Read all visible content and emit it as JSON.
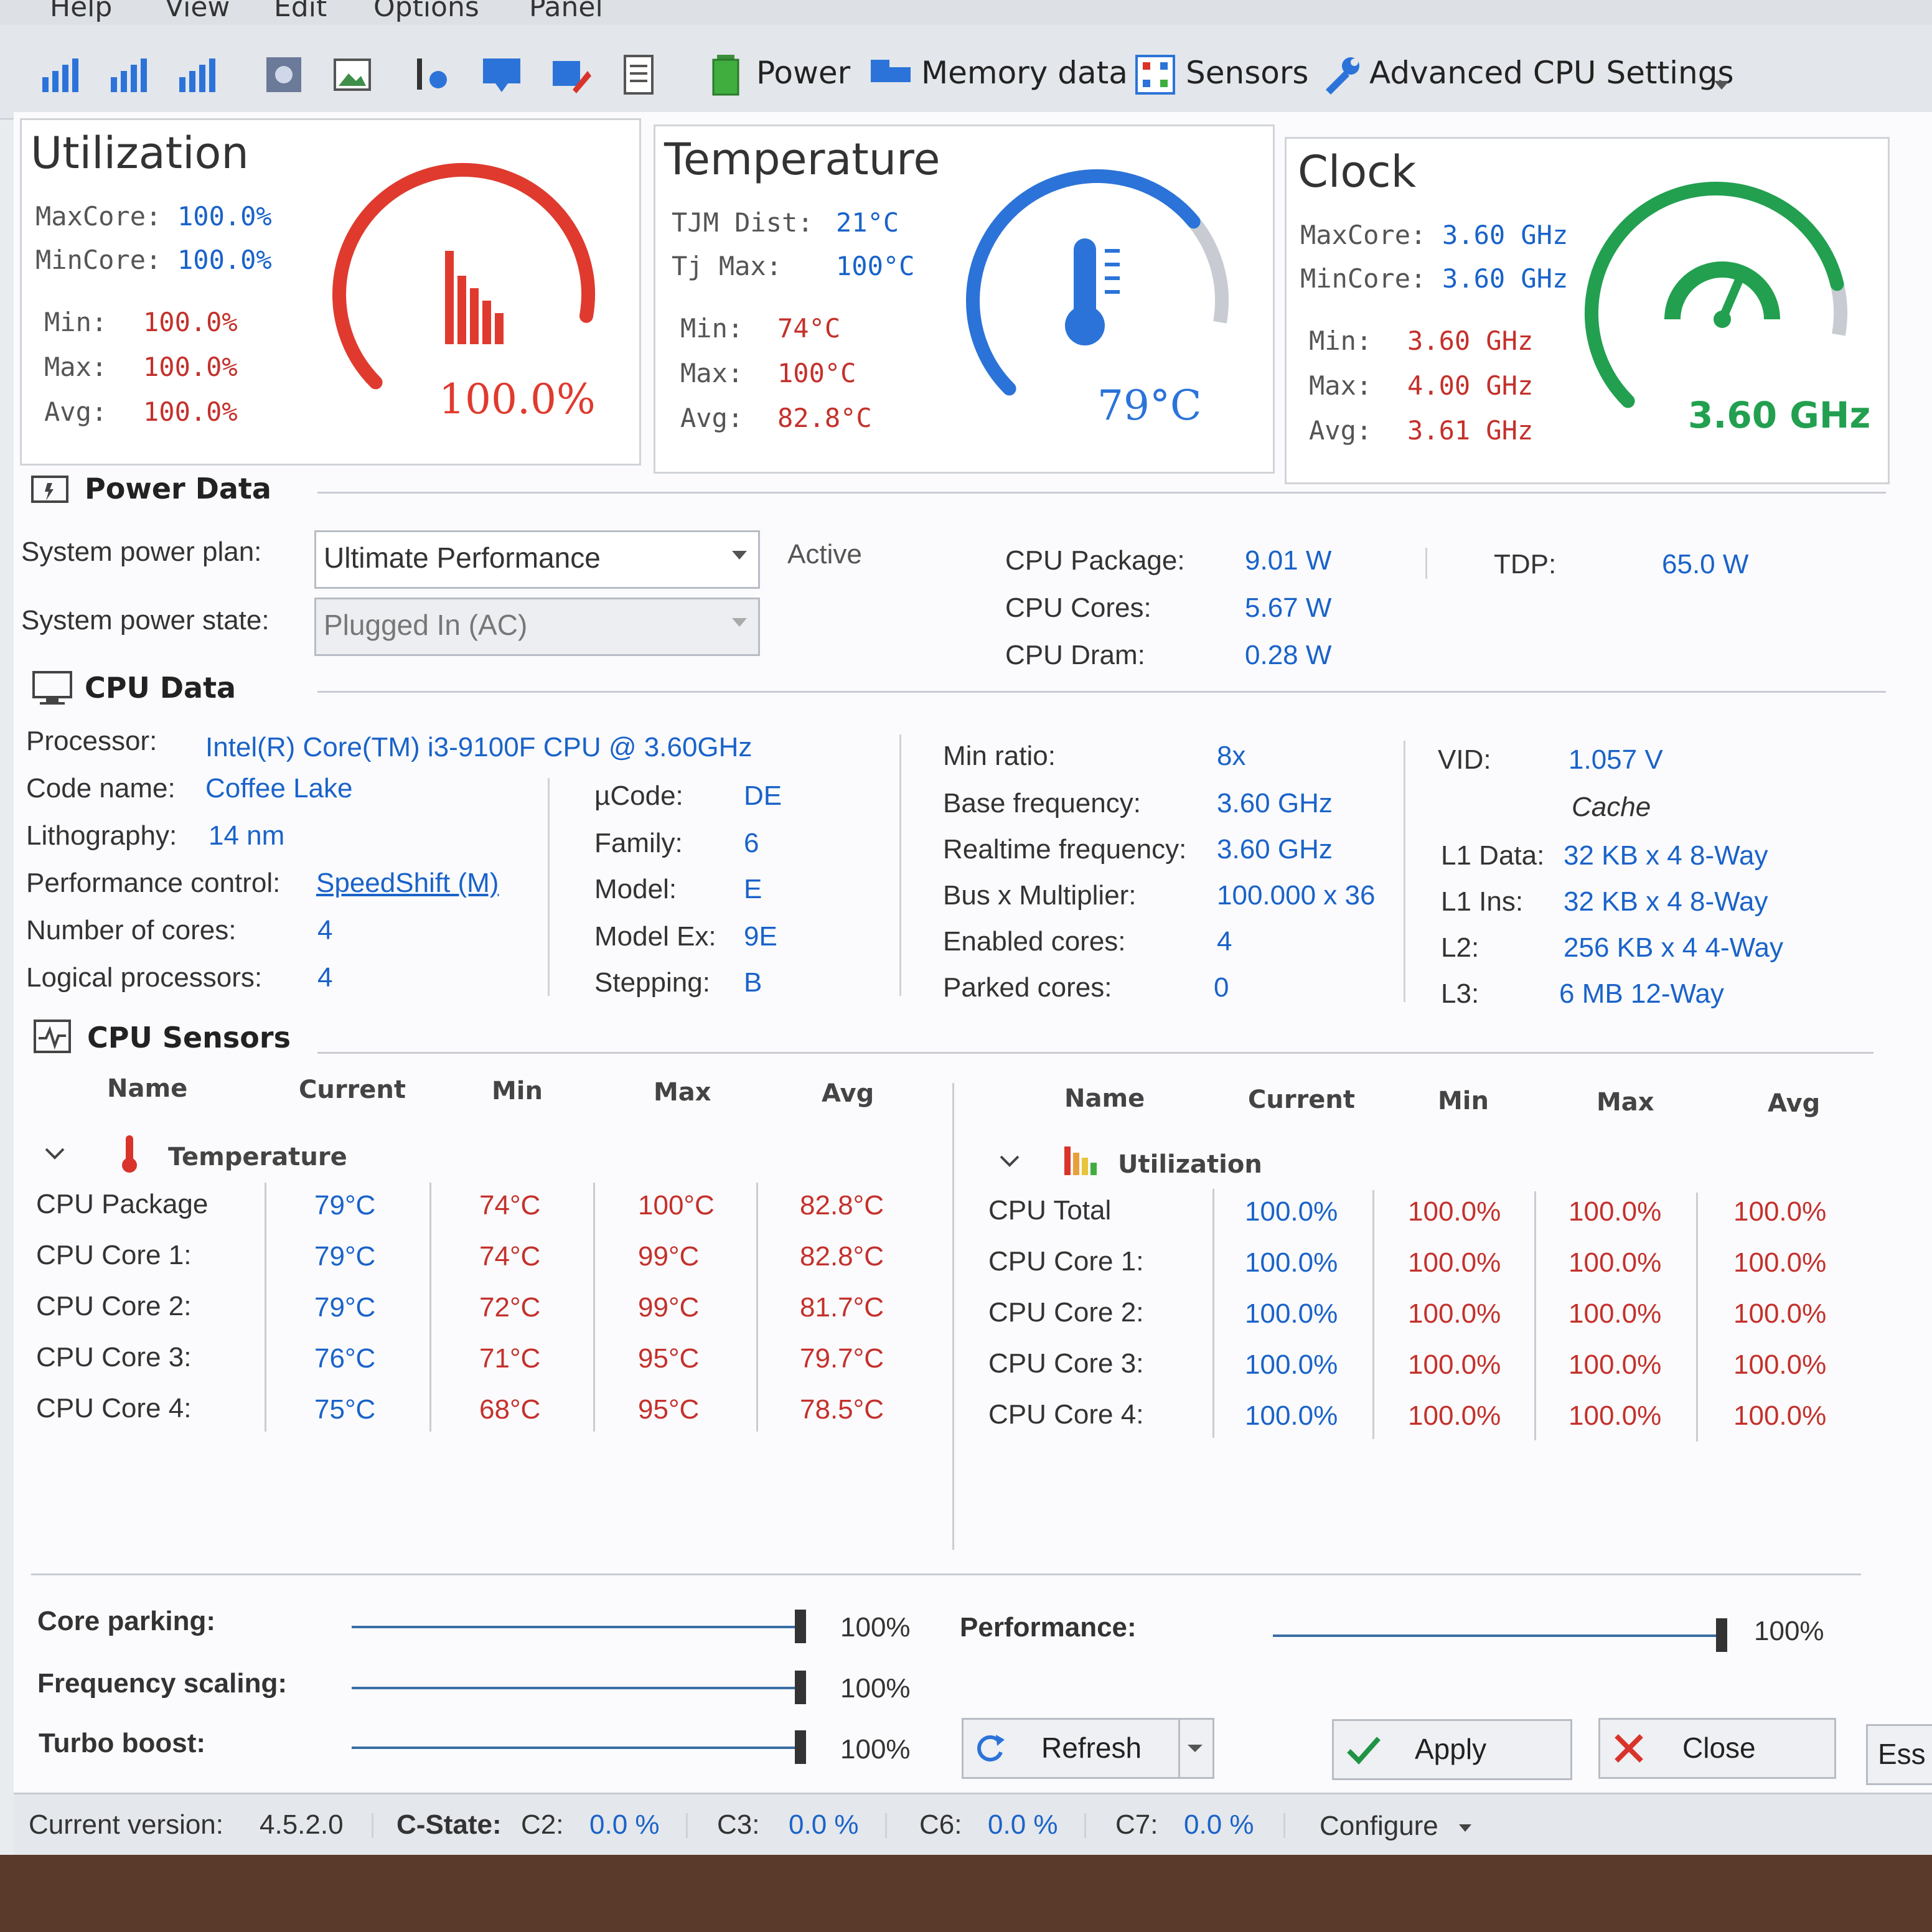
{
  "menu": [
    "Help",
    "View",
    "Edit",
    "Options",
    "Panel"
  ],
  "toolbar": {
    "power": "Power",
    "memory": "Memory data",
    "sensors": "Sensors",
    "advanced": "Advanced CPU Settings"
  },
  "utilization": {
    "title": "Utilization",
    "maxcore_label": "MaxCore:",
    "maxcore": "100.0%",
    "mincore_label": "MinCore:",
    "mincore": "100.0%",
    "min_label": "Min:",
    "min": "100.0%",
    "max_label": "Max:",
    "max": "100.0%",
    "avg_label": "Avg:",
    "avg": "100.0%",
    "gauge_value": "100.0%",
    "gauge_fraction": 1.0,
    "color": "#e03a2f"
  },
  "temperature": {
    "title": "Temperature",
    "tjm_label": "TJM Dist:",
    "tjm": "21°C",
    "tjmax_label": "Tj Max:",
    "tjmax": "100°C",
    "min_label": "Min:",
    "min": "74°C",
    "max_label": "Max:",
    "max": "100°C",
    "avg_label": "Avg:",
    "avg": "82.8°C",
    "gauge_value": "79°C",
    "gauge_fraction": 0.79,
    "color": "#2b73d9"
  },
  "clock": {
    "title": "Clock",
    "maxcore_label": "MaxCore:",
    "maxcore": "3.60 GHz",
    "mincore_label": "MinCore:",
    "mincore": "3.60 GHz",
    "min_label": "Min:",
    "min": "3.60 GHz",
    "max_label": "Max:",
    "max": "4.00 GHz",
    "avg_label": "Avg:",
    "avg": "3.61 GHz",
    "gauge_value": "3.60 GHz",
    "gauge_fraction": 0.9,
    "color": "#22a050"
  },
  "power": {
    "header": "Power Data",
    "plan_label": "System power plan:",
    "plan_value": "Ultimate Performance",
    "active": "Active",
    "state_label": "System power state:",
    "state_value": "Plugged In (AC)",
    "pkg_label": "CPU Package:",
    "pkg": "9.01 W",
    "cores_label": "CPU Cores:",
    "cores": "5.67 W",
    "dram_label": "CPU Dram:",
    "dram": "0.28 W",
    "tdp_label": "TDP:",
    "tdp": "65.0 W"
  },
  "cpu": {
    "header": "CPU Data",
    "processor_label": "Processor:",
    "processor": "Intel(R) Core(TM) i3-9100F CPU @ 3.60GHz",
    "codename_label": "Code name:",
    "codename": "Coffee Lake",
    "litho_label": "Lithography:",
    "litho": "14 nm",
    "perf_label": "Performance control:",
    "perf": "SpeedShift (M)",
    "cores_label": "Number of cores:",
    "cores": "4",
    "logical_label": "Logical processors:",
    "logical": "4",
    "ucode_label": "µCode:",
    "ucode": "DE",
    "family_label": "Family:",
    "family": "6",
    "model_label": "Model:",
    "model": "E",
    "modelex_label": "Model Ex:",
    "modelex": "9E",
    "stepping_label": "Stepping:",
    "stepping": "B",
    "minratio_label": "Min ratio:",
    "minratio": "8x",
    "basefreq_label": "Base frequency:",
    "basefreq": "3.60 GHz",
    "rtfreq_label": "Realtime frequency:",
    "rtfreq": "3.60 GHz",
    "busmult_label": "Bus x Multiplier:",
    "busmult": "100.000 x 36",
    "enabled_label": "Enabled cores:",
    "enabled": "4",
    "parked_label": "Parked cores:",
    "parked": "0",
    "vid_label": "VID:",
    "vid": "1.057 V",
    "cache_title": "Cache",
    "l1d_label": "L1 Data:",
    "l1d": "32 KB x 4  8-Way",
    "l1i_label": "L1 Ins:",
    "l1i": "32 KB x 4  8-Way",
    "l2_label": "L2:",
    "l2": "256 KB x 4  4-Way",
    "l3_label": "L3:",
    "l3": "6 MB  12-Way"
  },
  "sensors": {
    "header": "CPU Sensors",
    "cols": [
      "Name",
      "Current",
      "Min",
      "Max",
      "Avg"
    ],
    "temp_group": "Temperature",
    "temp_rows": [
      {
        "name": "CPU Package",
        "cur": "79°C",
        "min": "74°C",
        "max": "100°C",
        "avg": "82.8°C"
      },
      {
        "name": "CPU Core 1:",
        "cur": "79°C",
        "min": "74°C",
        "max": "99°C",
        "avg": "82.8°C"
      },
      {
        "name": "CPU Core 2:",
        "cur": "79°C",
        "min": "72°C",
        "max": "99°C",
        "avg": "81.7°C"
      },
      {
        "name": "CPU Core 3:",
        "cur": "76°C",
        "min": "71°C",
        "max": "95°C",
        "avg": "79.7°C"
      },
      {
        "name": "CPU Core 4:",
        "cur": "75°C",
        "min": "68°C",
        "max": "95°C",
        "avg": "78.5°C"
      }
    ],
    "util_group": "Utilization",
    "util_rows": [
      {
        "name": "CPU Total",
        "cur": "100.0%",
        "min": "100.0%",
        "max": "100.0%",
        "avg": "100.0%"
      },
      {
        "name": "CPU Core 1:",
        "cur": "100.0%",
        "min": "100.0%",
        "max": "100.0%",
        "avg": "100.0%"
      },
      {
        "name": "CPU Core 2:",
        "cur": "100.0%",
        "min": "100.0%",
        "max": "100.0%",
        "avg": "100.0%"
      },
      {
        "name": "CPU Core 3:",
        "cur": "100.0%",
        "min": "100.0%",
        "max": "100.0%",
        "avg": "100.0%"
      },
      {
        "name": "CPU Core 4:",
        "cur": "100.0%",
        "min": "100.0%",
        "max": "100.0%",
        "avg": "100.0%"
      }
    ]
  },
  "controls": {
    "parking_label": "Core parking:",
    "parking": "100%",
    "parking_frac": 1.0,
    "freq_label": "Frequency scaling:",
    "freq": "100%",
    "freq_frac": 1.0,
    "turbo_label": "Turbo boost:",
    "turbo": "100%",
    "turbo_frac": 1.0,
    "perf_label": "Performance:",
    "perf": "100%",
    "perf_frac": 1.0,
    "refresh": "Refresh",
    "apply": "Apply",
    "close": "Close",
    "ess": "Ess"
  },
  "status": {
    "version_label": "Current version:",
    "version": "4.5.2.0",
    "cstate_label": "C-State:",
    "c2_label": "C2:",
    "c2": "0.0 %",
    "c3_label": "C3:",
    "c3": "0.0 %",
    "c6_label": "C6:",
    "c6": "0.0 %",
    "c7_label": "C7:",
    "c7": "0.0 %",
    "configure": "Configure"
  }
}
